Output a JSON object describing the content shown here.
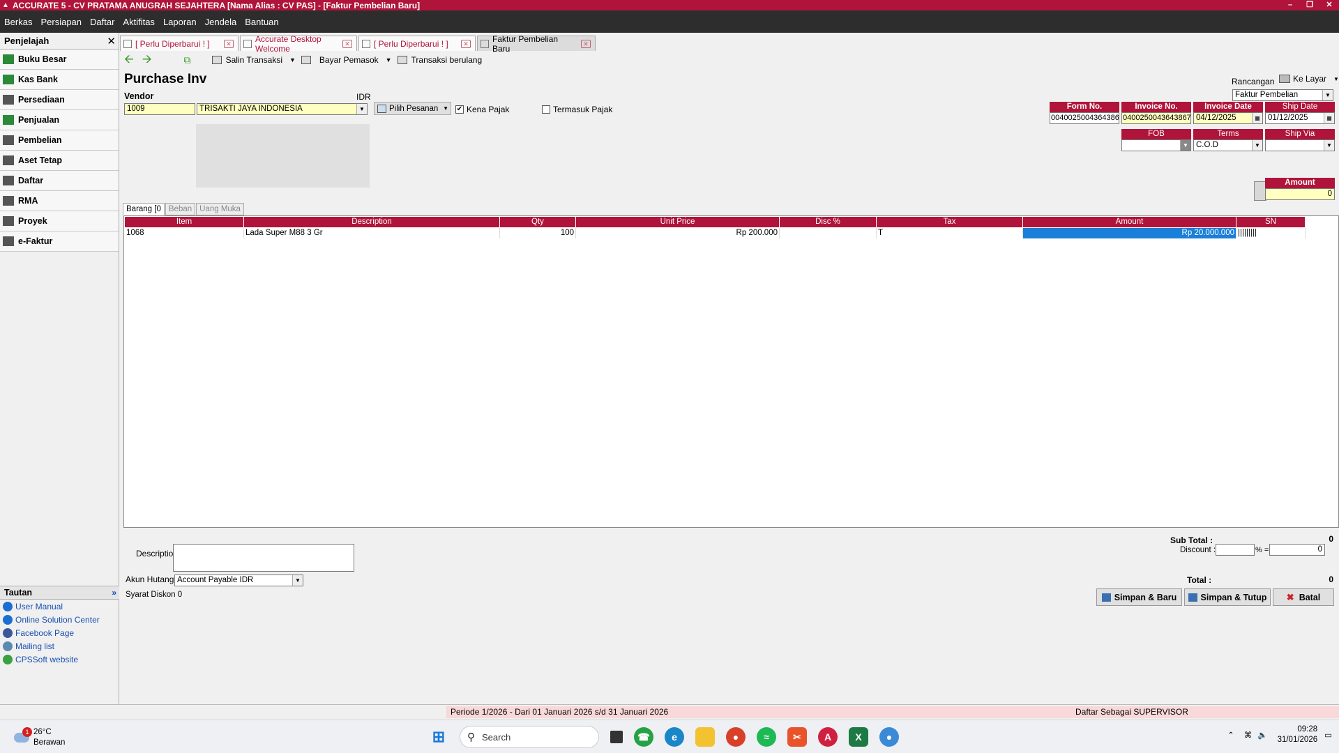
{
  "window": {
    "title": "ACCURATE 5  - CV PRATAMA ANUGRAH SEJAHTERA  [Nama Alias : CV PAS] - [Faktur Pembelian Baru]",
    "minimize": "–",
    "restore": "❐",
    "close": "✕"
  },
  "menu": [
    "Berkas",
    "Persiapan",
    "Daftar",
    "Aktifitas",
    "Laporan",
    "Jendela",
    "Bantuan"
  ],
  "sidebar": {
    "title": "Penjelajah",
    "items": [
      {
        "label": "Buku Besar",
        "icon": "ledger-icon",
        "color": "#2a8a3a"
      },
      {
        "label": "Kas Bank",
        "icon": "cash-bank-icon",
        "color": "#2a8a3a"
      },
      {
        "label": "Persediaan",
        "icon": "inventory-icon",
        "color": "#555555"
      },
      {
        "label": "Penjualan",
        "icon": "sales-icon",
        "color": "#2a8a3a"
      },
      {
        "label": "Pembelian",
        "icon": "purchase-icon",
        "color": "#555555"
      },
      {
        "label": "Aset Tetap",
        "icon": "fixed-asset-icon",
        "color": "#555555"
      },
      {
        "label": "Daftar",
        "icon": "list-icon",
        "color": "#555555"
      },
      {
        "label": "RMA",
        "icon": "rma-icon",
        "color": "#555555"
      },
      {
        "label": "Proyek",
        "icon": "project-icon",
        "color": "#555555"
      },
      {
        "label": "e-Faktur",
        "icon": "efaktur-icon",
        "color": "#555555"
      }
    ]
  },
  "tautan": {
    "title": "Tautan",
    "links": [
      {
        "label": "User Manual",
        "icon": "help-icon",
        "color": "#1a6fd0"
      },
      {
        "label": "Online Solution Center",
        "icon": "help-icon",
        "color": "#1a6fd0"
      },
      {
        "label": "Facebook Page",
        "icon": "facebook-icon",
        "color": "#3b5998"
      },
      {
        "label": "Mailing list",
        "icon": "mailing-icon",
        "color": "#5a8ab0"
      },
      {
        "label": "CPSSoft website",
        "icon": "website-icon",
        "color": "#3aa040"
      }
    ]
  },
  "tabs": [
    {
      "label": "[ Perlu Diperbarui ! ]",
      "active": false
    },
    {
      "label": "Accurate Desktop Welcome",
      "active": false
    },
    {
      "label": "[ Perlu Diperbarui ! ]",
      "active": false
    },
    {
      "label": "Faktur Pembelian Baru",
      "active": true
    }
  ],
  "toolbar": {
    "salin": "Salin Transaksi",
    "bayar": "Bayar Pemasok",
    "berulang": "Transaksi berulang"
  },
  "form": {
    "title": "Purchase Inv",
    "vendor_label": "Vendor",
    "currency": "IDR",
    "vendor_code": "1009",
    "vendor_name": "TRISAKTI JAYA INDONESIA",
    "pilih_pesanan": "Pilih Pesanan",
    "kena_pajak": "Kena Pajak",
    "kena_pajak_checked": "✔",
    "termasuk_pajak": "Termasuk Pajak",
    "rancangan_label": "Rancangan",
    "ke_layar": "Ke Layar",
    "template": "Faktur Pembelian",
    "form_no_label": "Form No.",
    "form_no": "0040025004364386",
    "invoice_no_label": "Invoice No.",
    "invoice_no": "0400250043643867",
    "invoice_date_label": "Invoice Date",
    "invoice_date": "04/12/2025",
    "ship_date_label": "Ship Date",
    "ship_date": "01/12/2025",
    "fob_label": "FOB",
    "fob": "",
    "terms_label": "Terms",
    "terms": "C.O.D",
    "ship_via_label": "Ship Via",
    "ship_via": "",
    "amount_label": "Amount",
    "amount": "0"
  },
  "subtabs": [
    "Barang [0",
    "Beban",
    "Uang Muka"
  ],
  "grid": {
    "columns": [
      "Item",
      "Description",
      "Qty",
      "Unit Price",
      "Disc %",
      "Tax",
      "Amount",
      "SN"
    ],
    "rows": [
      {
        "item": "1068",
        "description": "Lada Super M88 3 Gr",
        "qty": "100",
        "unit_price": "Rp 200.000",
        "disc": "",
        "tax": "T",
        "amount": "Rp 20.000.000",
        "sn": "|||||||||"
      }
    ]
  },
  "footer": {
    "description_label": "Description",
    "akun_label": "Akun Hutang",
    "akun_value": "Account Payable IDR",
    "subtotal_label": "Sub Total :",
    "subtotal": "0",
    "discount_label": "Discount :",
    "discount_pct": "",
    "pct_sign": "% =",
    "discount_value": "0",
    "total_label": "Total :",
    "total": "0",
    "syarat": "Syarat Diskon 0",
    "simpan_baru": "Simpan & Baru",
    "simpan_tutup": "Simpan & Tutup",
    "batal": "Batal"
  },
  "status": {
    "periode": "Periode 1/2026 - Dari 01 Januari 2026 s/d 31 Januari 2026",
    "daftar": "Daftar Sebagai SUPERVISOR"
  },
  "taskbar": {
    "temp": "26°C",
    "weather": "Berawan",
    "notif_count": "1",
    "search_placeholder": "Search",
    "time": "09:28",
    "date": "31/01/2026"
  }
}
